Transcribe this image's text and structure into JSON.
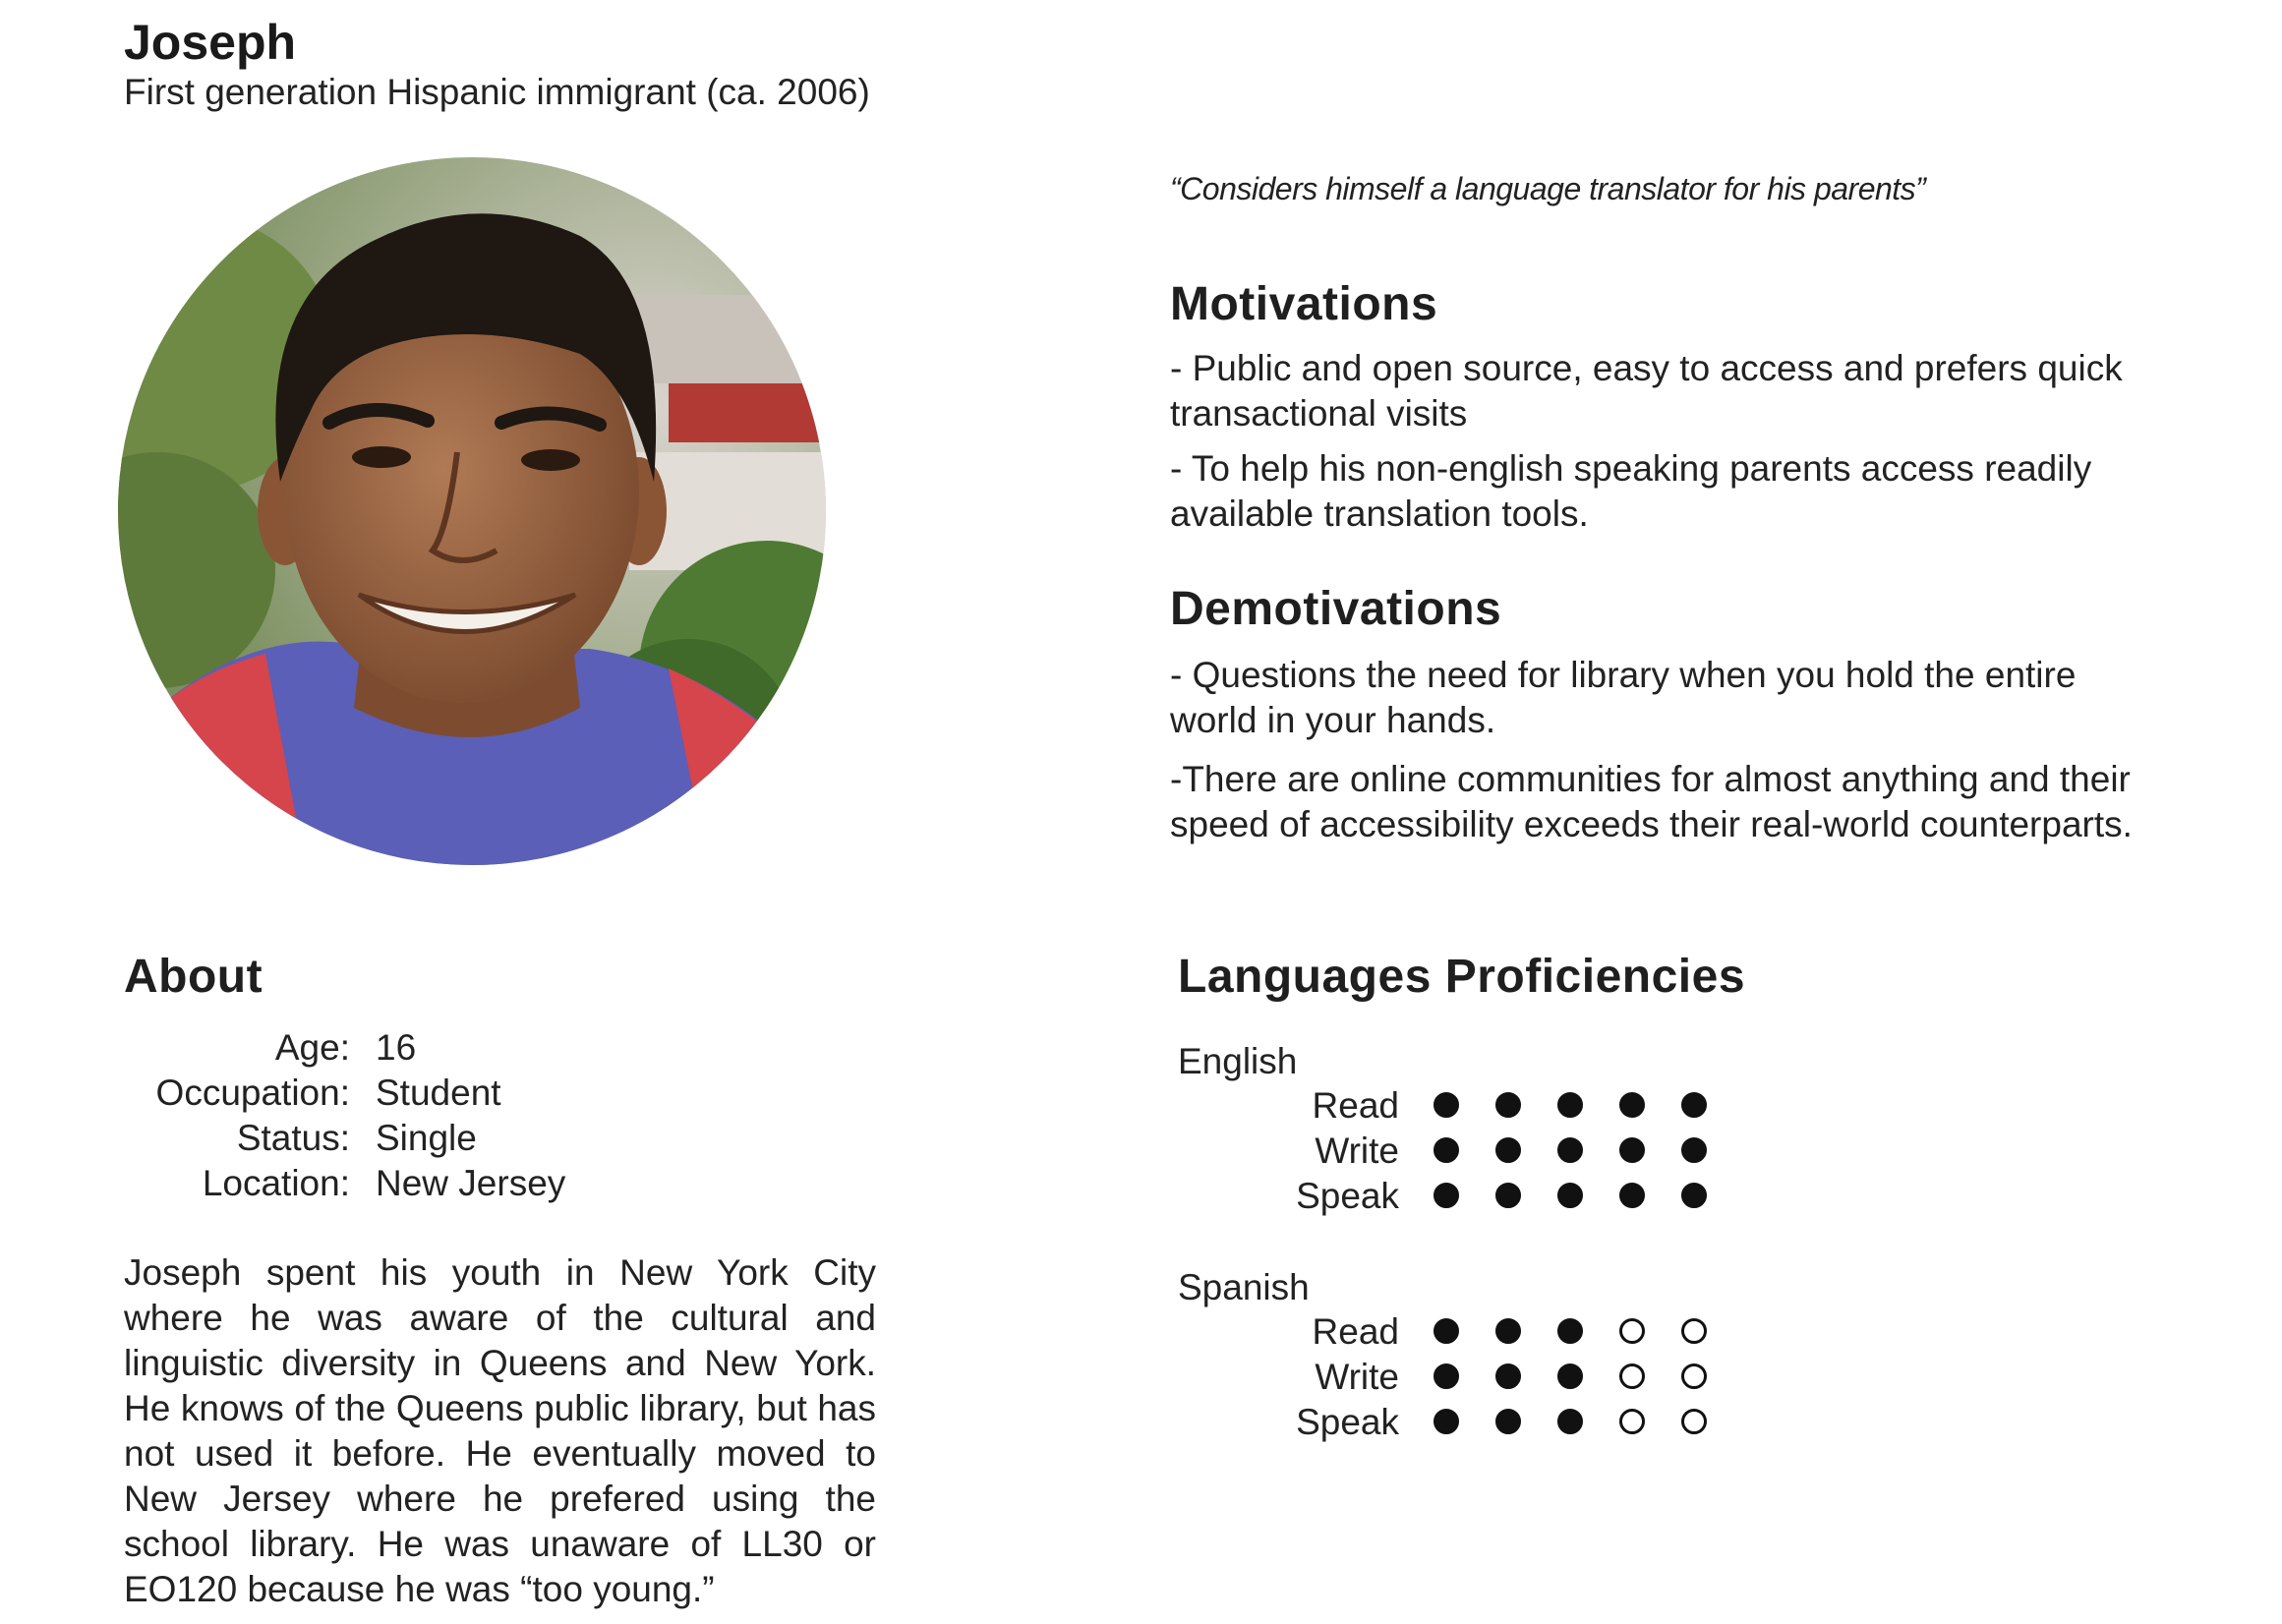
{
  "persona": {
    "name": "Joseph",
    "subtitle": "First generation Hispanic immigrant (ca. 2006)",
    "quote": "“Considers himself a language translator for his parents”"
  },
  "motivations": {
    "heading": "Motivations",
    "items": [
      "- Public and open source, easy to access and prefers quick transactional visits",
      "- To help his non-english speaking parents access readily available translation tools."
    ]
  },
  "demotivations": {
    "heading": "Demotivations",
    "items": [
      "- Questions the need for library when you hold the entire world in your hands.",
      "-There are online communities for almost anything and their speed of accessibility exceeds their real-world counterparts."
    ]
  },
  "about": {
    "heading": "About",
    "fields": [
      {
        "label": "Age:",
        "value": "16"
      },
      {
        "label": "Occupation:",
        "value": "Student"
      },
      {
        "label": "Status:",
        "value": "Single"
      },
      {
        "label": "Location:",
        "value": "New Jersey"
      }
    ],
    "bio": "Joseph spent his youth in New York City where he was aware of the cultural and linguistic diversity in Queens and New York. He knows of the Queens public library, but has not used it before. He eventually moved to New Jersey where he prefered using the school library. He was unaware of LL30 or EO120 because he was “too young.”"
  },
  "languages": {
    "heading": "Languages Proficiencies",
    "max_level": 5,
    "list": [
      {
        "name": "English",
        "skills": [
          {
            "label": "Read",
            "level": 5
          },
          {
            "label": "Write",
            "level": 5
          },
          {
            "label": "Speak",
            "level": 5
          }
        ]
      },
      {
        "name": "Spanish",
        "skills": [
          {
            "label": "Read",
            "level": 3
          },
          {
            "label": "Write",
            "level": 3
          },
          {
            "label": "Speak",
            "level": 3
          }
        ]
      }
    ]
  }
}
